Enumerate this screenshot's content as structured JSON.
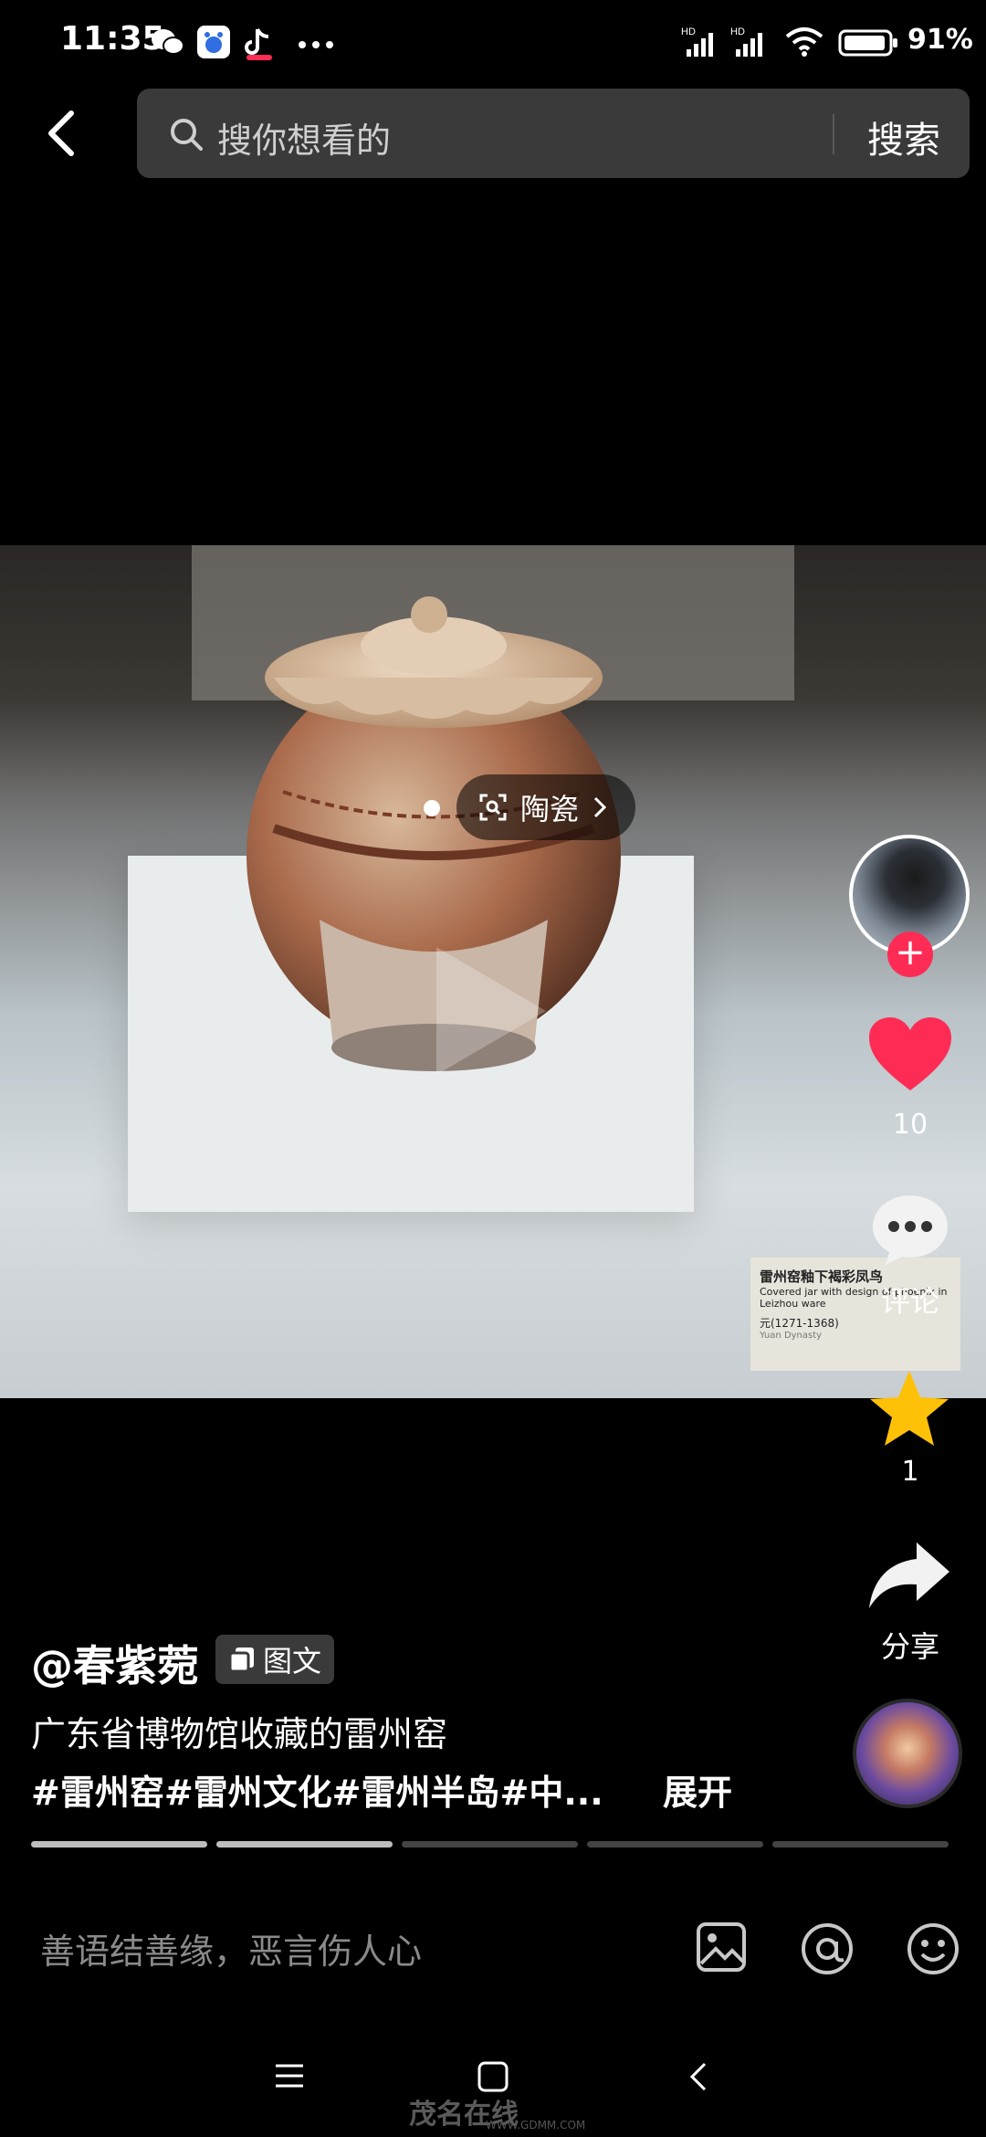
{
  "status_bar": {
    "time": "11:35",
    "battery": "91%",
    "indicators": [
      "wechat-icon",
      "baidu-icon",
      "tiktok-icon",
      "more-icon",
      "hd-signal-icon",
      "hd-signal-icon",
      "wifi-icon",
      "battery-icon"
    ]
  },
  "search": {
    "placeholder": "搜你想看的",
    "button": "搜索"
  },
  "photo": {
    "tag_label": "陶瓷",
    "card_title": "雷州窑釉下褐彩凤鸟",
    "card_sub": "Covered jar with design of phoenix in Leizhou ware",
    "card_date": "元(1271-1368)",
    "card_foot": "Yuan Dynasty"
  },
  "sidebar": {
    "like_count": "10",
    "comment_label": "评论",
    "favorite_count": "1",
    "share_label": "分享"
  },
  "post": {
    "author": "@春紫菀",
    "badge": "图文",
    "description": "广东省博物馆收藏的雷州窑",
    "tags": "#雷州窑#雷州文化#雷州半岛#中...",
    "expand": "展开"
  },
  "progress": {
    "total": 5,
    "done": 2
  },
  "comment_bar": {
    "placeholder": "善语结善缘，恶言伤人心"
  },
  "watermark": {
    "text": "茂名在线",
    "url": "WWW.GDMM.COM"
  },
  "colors": {
    "accent": "#fe2c55",
    "star": "#ffc107"
  }
}
